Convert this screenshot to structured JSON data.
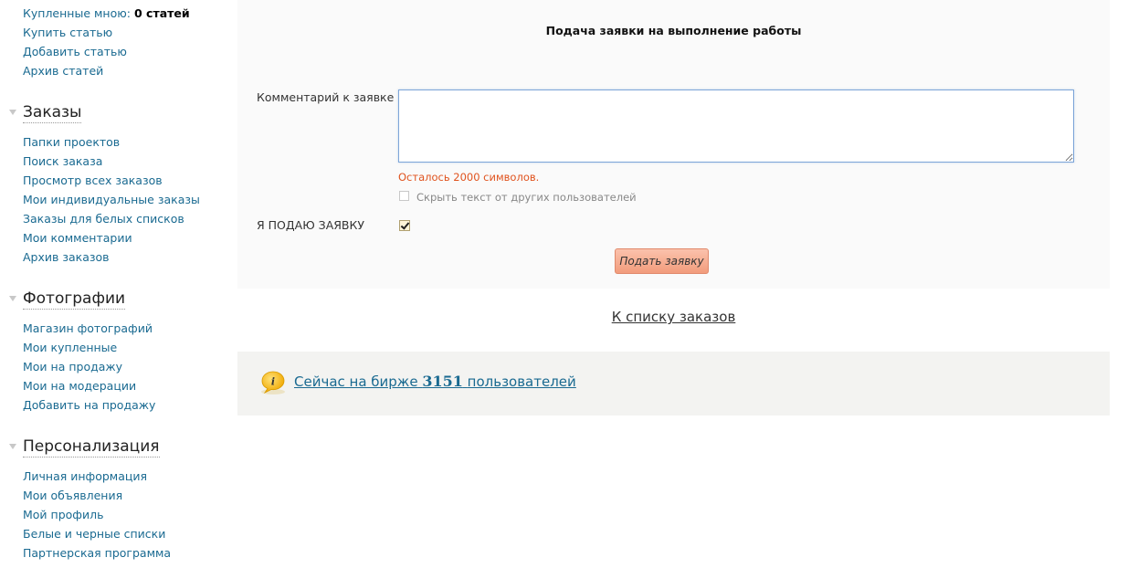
{
  "sidebar": {
    "articles": {
      "bought_label": "Купленные мною:",
      "bought_count": "0 статей",
      "links": [
        "Купить статью",
        "Добавить статью",
        "Архив статей"
      ]
    },
    "orders": {
      "title": "Заказы",
      "links": [
        "Папки проектов",
        "Поиск заказа",
        "Просмотр всех заказов",
        "Мои индивидуальные заказы",
        "Заказы для белых списков",
        "Мои комментарии",
        "Архив заказов"
      ]
    },
    "photos": {
      "title": "Фотографии",
      "links": [
        "Магазин фотографий",
        "Мои купленные",
        "Мои на продажу",
        "Мои на модерации",
        "Добавить на продажу"
      ]
    },
    "personal": {
      "title": "Персонализация",
      "links": [
        "Личная информация",
        "Мои объявления",
        "Мой профиль",
        "Белые и черные списки",
        "Партнерская программа"
      ]
    }
  },
  "form": {
    "title": "Подача заявки на выполнение работы",
    "comment_label": "Комментарий к заявке",
    "comment_value": "",
    "remaining": "Осталось 2000 символов.",
    "hide_label": "Скрыть текст от других пользователей",
    "hide_checked": false,
    "apply_label": "Я ПОДАЮ ЗАЯВКУ",
    "apply_checked": true,
    "submit_label": "Подать заявку"
  },
  "back_link": "К списку заказов",
  "info": {
    "prefix": "Сейчас на бирже",
    "count": "3151",
    "suffix": "пользователей",
    "icon": "info-bubble-icon"
  },
  "colors": {
    "link": "#1a6a91",
    "warning": "#e0531e",
    "button": "#f29c7c",
    "icon": "#f5b400"
  }
}
